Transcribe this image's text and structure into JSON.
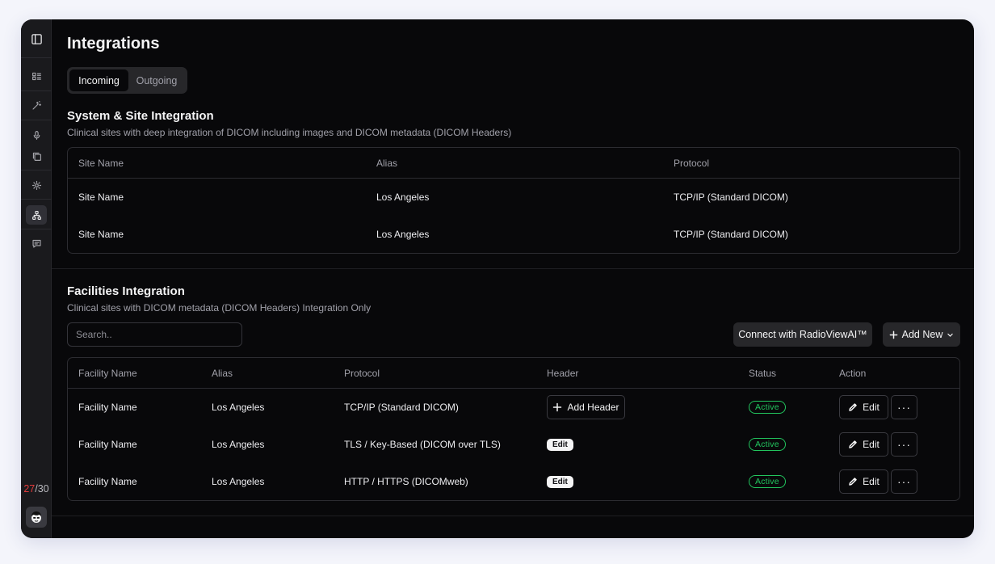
{
  "page": {
    "title": "Integrations"
  },
  "tabs": [
    {
      "label": "Incoming",
      "active": true
    },
    {
      "label": "Outgoing",
      "active": false
    }
  ],
  "sidebar": {
    "icons": [
      "sidebar-toggle-icon",
      "list-icon",
      "magic-wand-icon",
      "microphone-icon",
      "copy-icon",
      "gear-icon",
      "sitemap-icon",
      "message-icon"
    ],
    "counter_current": "27",
    "counter_sep": "/",
    "counter_total": "30"
  },
  "system": {
    "title": "System & Site Integration",
    "subtitle": "Clinical sites with deep integration of DICOM including images and DICOM metadata (DICOM Headers)",
    "columns": [
      "Site Name",
      "Alias",
      "Protocol"
    ],
    "rows": [
      [
        "Site Name",
        "Los Angeles",
        "TCP/IP (Standard DICOM)"
      ],
      [
        "Site Name",
        "Los Angeles",
        "TCP/IP (Standard DICOM)"
      ]
    ]
  },
  "facilities": {
    "title": "Facilities Integration",
    "subtitle": "Clinical sites with DICOM metadata (DICOM Headers) Integration Only",
    "search_placeholder": "Search..",
    "connect_label": "Connect with RadioViewAI™",
    "add_new_label": "Add New",
    "columns": [
      "Facility Name",
      "Alias",
      "Protocol",
      "Header",
      "Status",
      "Action"
    ],
    "add_header_label": "Add Header",
    "edit_chip_label": "Edit",
    "edit_label": "Edit",
    "more_label": "···",
    "rows": [
      {
        "name": "Facility Name",
        "alias": "Los Angeles",
        "protocol": "TCP/IP (Standard DICOM)",
        "status": "Active"
      },
      {
        "name": "Facility Name",
        "alias": "Los Angeles",
        "protocol": "TLS / Key-Based (DICOM over TLS)",
        "status": "Active"
      },
      {
        "name": "Facility Name",
        "alias": "Los Angeles",
        "protocol": "HTTP / HTTPS (DICOMweb)",
        "status": "Active"
      }
    ]
  },
  "colors": {
    "background": "#08080a",
    "panel": "#27272a",
    "active_status": "#22c55e",
    "counter_highlight": "#e23b3b"
  }
}
